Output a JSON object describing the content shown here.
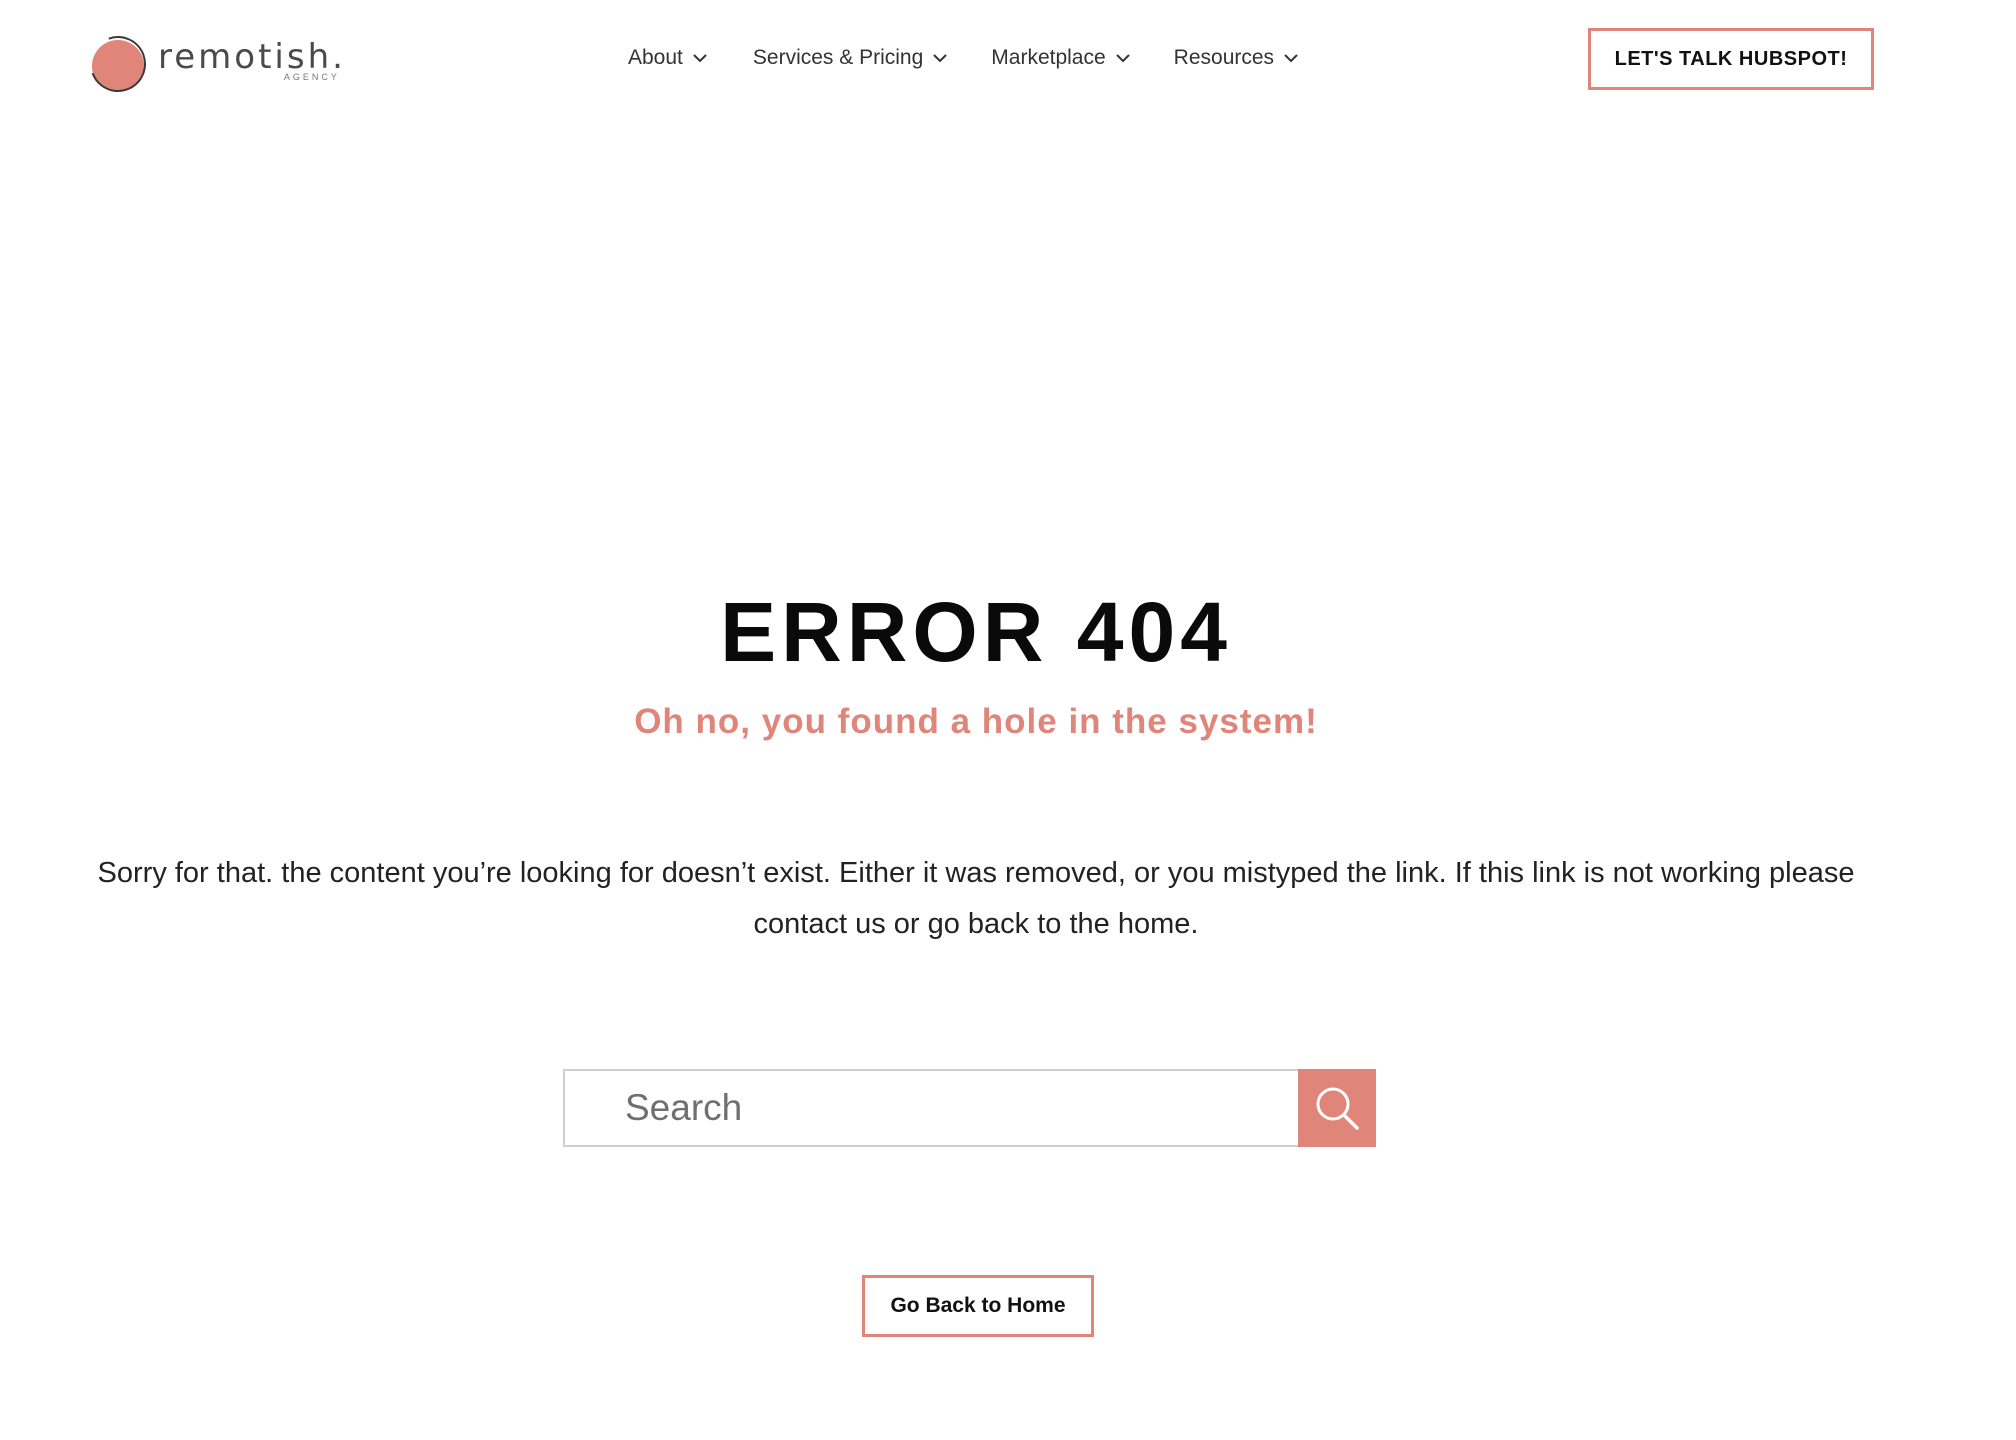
{
  "colors": {
    "accent": "#e0857a",
    "text": "#111111",
    "muted": "#333333"
  },
  "header": {
    "logo": {
      "word": "remotish.",
      "sub": "AGENCY"
    },
    "nav": [
      {
        "label": "About",
        "icon": "chevron-down-icon"
      },
      {
        "label": "Services & Pricing",
        "icon": "chevron-down-icon"
      },
      {
        "label": "Marketplace",
        "icon": "chevron-down-icon"
      },
      {
        "label": "Resources",
        "icon": "chevron-down-icon"
      }
    ],
    "cta_label": "LET'S TALK HUBSPOT!"
  },
  "main": {
    "title": "ERROR 404",
    "subtitle": "Oh no, you found a hole in the system!",
    "body": "Sorry for that. the content you’re looking for doesn’t exist. Either it was removed, or you mistyped the link. If this link is not working please contact us or go back to the home.",
    "search": {
      "placeholder": "Search",
      "value": "",
      "icon": "search-icon"
    },
    "home_button_label": "Go Back to Home"
  }
}
